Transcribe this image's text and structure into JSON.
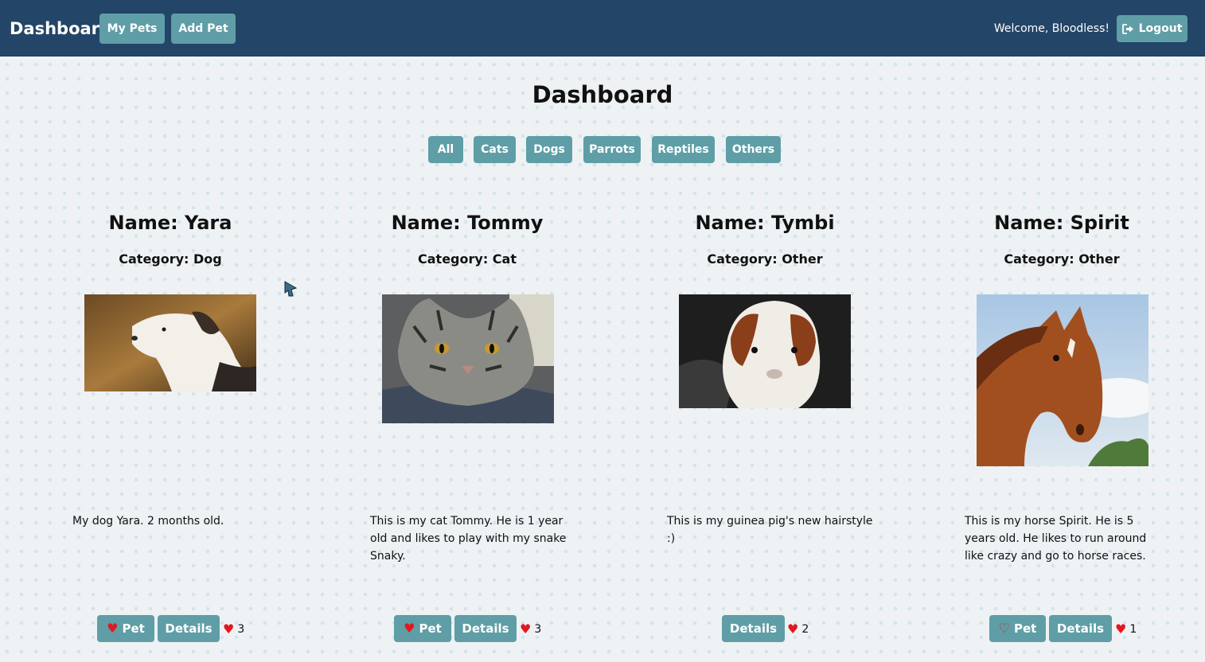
{
  "navbar": {
    "brand": "Dashboard",
    "my_pets": "My Pets",
    "add_pet": "Add Pet",
    "welcome": "Welcome, Bloodless!",
    "logout": "Logout"
  },
  "main": {
    "title": "Dashboard",
    "filters": [
      "All",
      "Cats",
      "Dogs",
      "Parrots",
      "Reptiles",
      "Others"
    ]
  },
  "pets": [
    {
      "name": "Name: Yara",
      "category": "Category: Dog",
      "description": "My dog Yara. 2 months old.",
      "pet_label": "Pet",
      "details_label": "Details",
      "likes": "3",
      "image_icon": "dog-photo"
    },
    {
      "name": "Name: Tommy",
      "category": "Category: Cat",
      "description": "This is my cat Tommy. He is 1 year old and likes to play with my snake Snaky.",
      "pet_label": "Pet",
      "details_label": "Details",
      "likes": "3",
      "image_icon": "cat-photo"
    },
    {
      "name": "Name: Tymbi",
      "category": "Category: Other",
      "description": "This is my guinea pig's new hairstyle :)",
      "details_label": "Details",
      "likes": "2",
      "image_icon": "guinea-pig-photo"
    },
    {
      "name": "Name: Spirit",
      "category": "Category: Other",
      "description": "This is my horse Spirit. He is 5 years old. He likes to run around like crazy and go to horse races.",
      "pet_label": "Pet",
      "details_label": "Details",
      "likes": "1",
      "image_icon": "horse-photo"
    }
  ],
  "colors": {
    "navbar": "#234567",
    "button": "#5f9ea6",
    "heart": "#e3171f",
    "background": "#eef2f4"
  }
}
